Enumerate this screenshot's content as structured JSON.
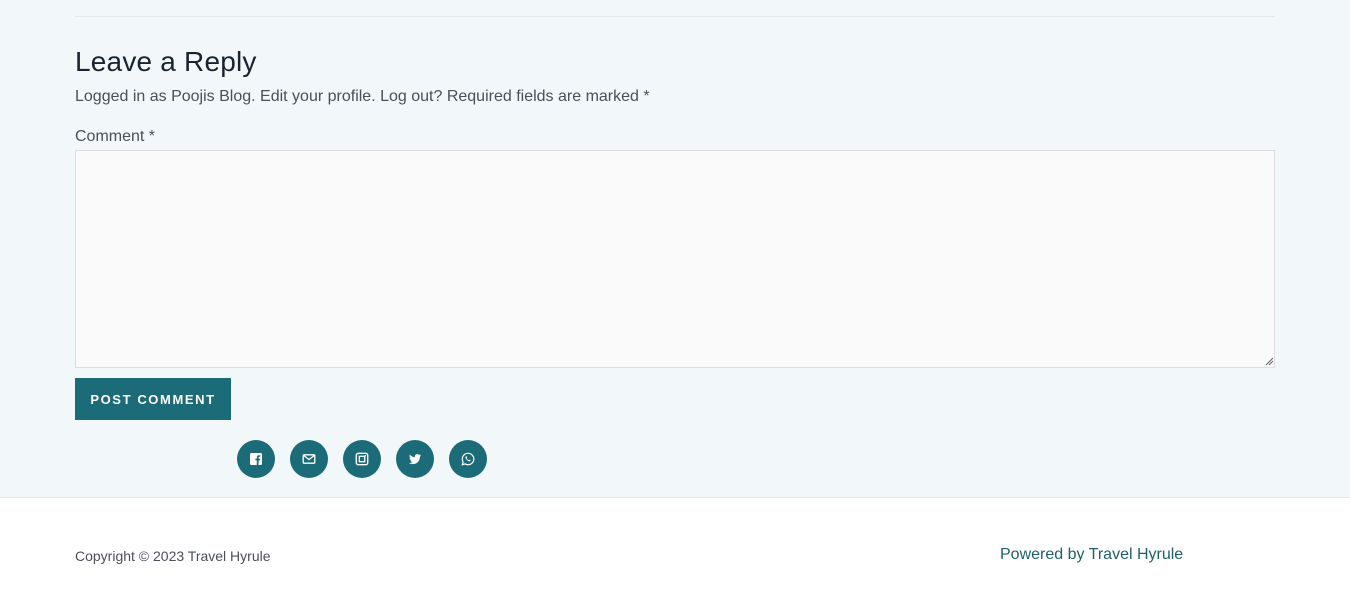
{
  "reply": {
    "title": "Leave a Reply",
    "logged_prefix": "Logged in as Poojis Blog.",
    "edit_profile": "Edit your profile.",
    "log_out": "Log out?",
    "required_note": "Required fields are marked *",
    "comment_label": "Comment *",
    "comment_value": "",
    "submit_label": "POST COMMENT"
  },
  "social": {
    "items": [
      {
        "icon": "facebook-icon"
      },
      {
        "icon": "mail-icon"
      },
      {
        "icon": "instagram-icon"
      },
      {
        "icon": "twitter-icon"
      },
      {
        "icon": "whatsapp-icon"
      }
    ],
    "color": "#1b6b78"
  },
  "footer": {
    "copyright": "Copyright © 2023 Travel Hyrule",
    "powered_prefix": "Powered by",
    "powered_link": "Travel Hyrule"
  },
  "colors": {
    "section_bg": "#f2f7f9",
    "accent": "#1b6b78"
  }
}
